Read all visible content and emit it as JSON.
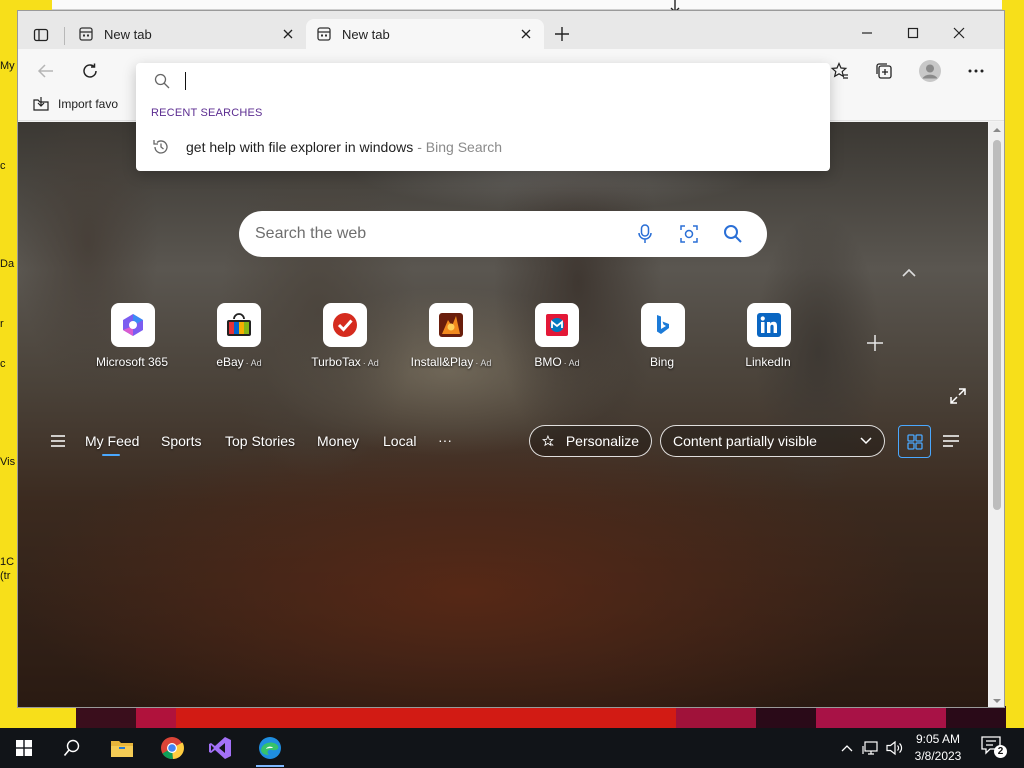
{
  "desktop": {
    "side_labels": [
      "My",
      "c",
      "Da",
      "r",
      "c",
      "Vis",
      "1C",
      "(tr"
    ]
  },
  "browser": {
    "tabs": [
      {
        "title": "New tab",
        "icon": "new-tab-page-icon"
      },
      {
        "title": "New tab",
        "icon": "new-tab-page-icon"
      }
    ],
    "favorites_bar": {
      "import_label": "Import favo"
    },
    "address_dropdown": {
      "query": "",
      "recent_heading": "RECENT SEARCHES",
      "recent_items": [
        {
          "query": "get help with file explorer in windows",
          "source": "- Bing Search"
        }
      ]
    }
  },
  "ntp": {
    "search_placeholder": "Search the web",
    "quick_links": [
      {
        "label": "Microsoft 365",
        "ad": "",
        "icon": "microsoft-365-icon"
      },
      {
        "label": "eBay",
        "ad": "· Ad",
        "icon": "ebay-icon"
      },
      {
        "label": "TurboTax",
        "ad": "· Ad",
        "icon": "turbotax-icon"
      },
      {
        "label": "Install&Play",
        "ad": "· Ad",
        "icon": "install-play-icon"
      },
      {
        "label": "BMO",
        "ad": "· Ad",
        "icon": "bmo-icon"
      },
      {
        "label": "Bing",
        "ad": "",
        "icon": "bing-icon"
      },
      {
        "label": "LinkedIn",
        "ad": "",
        "icon": "linkedin-icon"
      }
    ],
    "feed_tabs": [
      "My Feed",
      "Sports",
      "Top Stories",
      "Money",
      "Local"
    ],
    "feed_more": "···",
    "personalize_label": "Personalize",
    "content_visibility": "Content partially visible"
  },
  "taskbar": {
    "apps": [
      "start",
      "search",
      "file-explorer",
      "chrome",
      "visual-studio",
      "edge"
    ],
    "time": "9:05 AM",
    "date": "3/8/2023",
    "notification_count": "2"
  },
  "colors": {
    "desktop_yellow": "#f7df1a",
    "taskbar": "#111418",
    "accent_blue": "#4aa8ff",
    "recent_heading": "#5c2d91"
  }
}
